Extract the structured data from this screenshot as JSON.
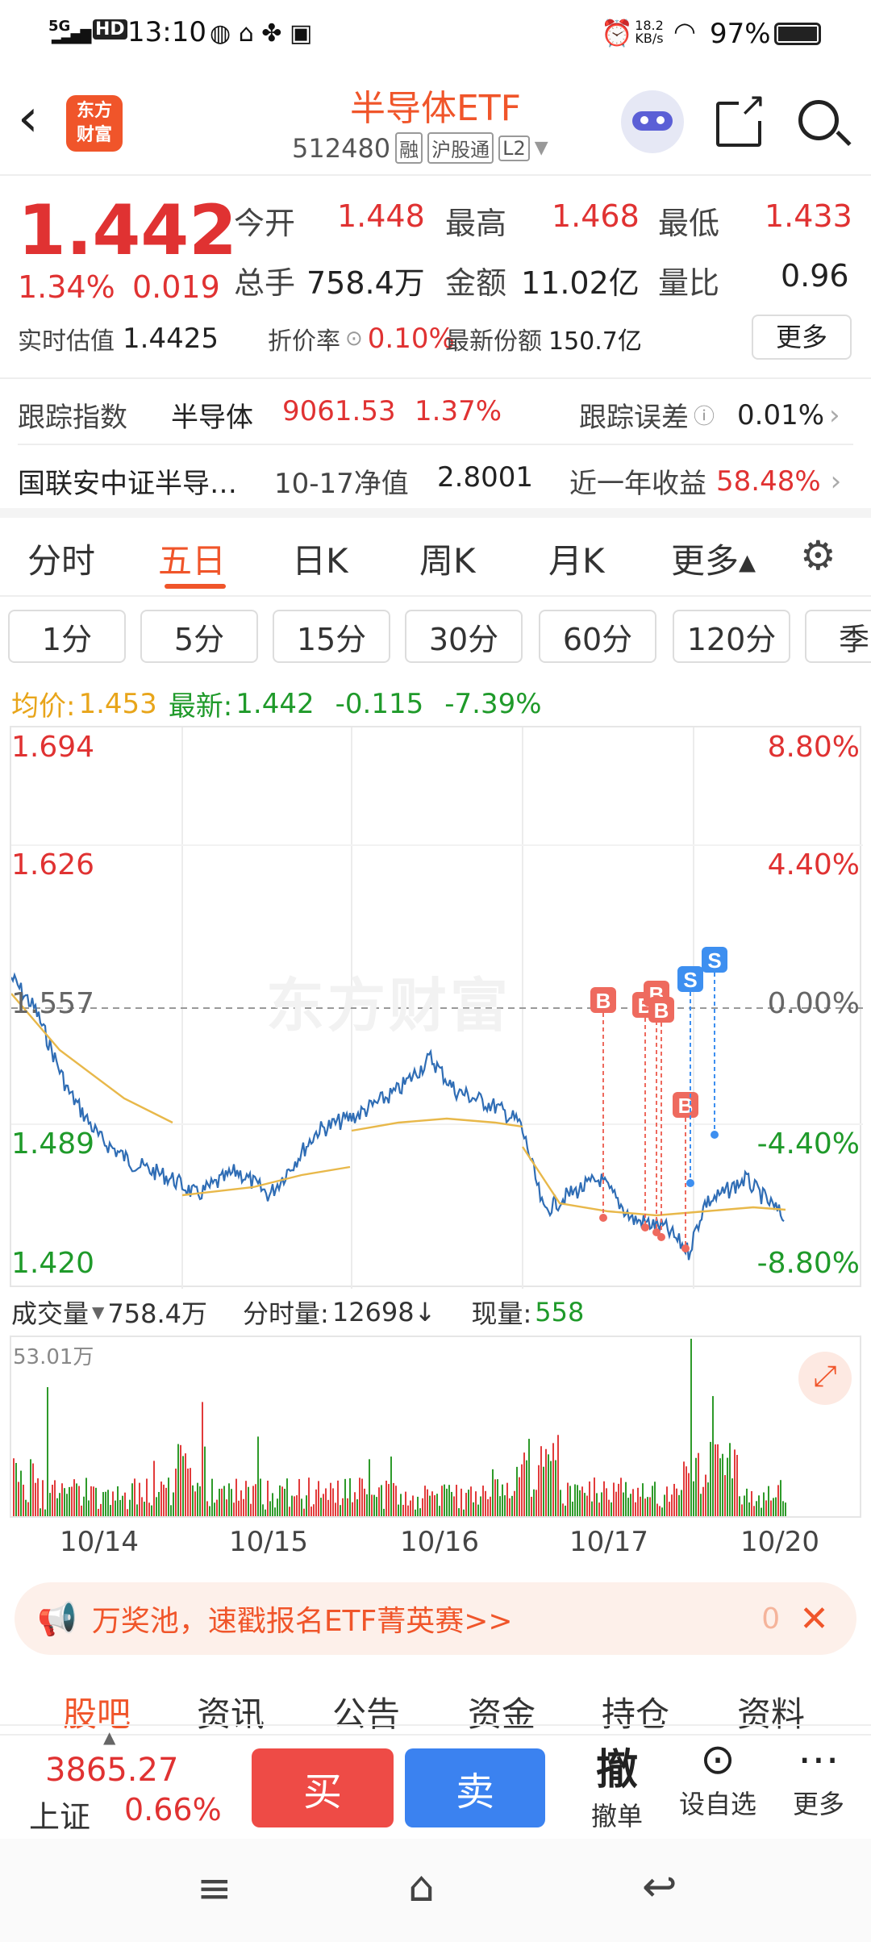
{
  "status": {
    "network": "5G",
    "hd": "HD",
    "time": "13:10",
    "speed": "18.2\nKB/s",
    "battery": "97%"
  },
  "header": {
    "brand_line1": "东方",
    "brand_line2": "财富",
    "title": "半导体ETF",
    "code": "512480",
    "tags": [
      "融",
      "沪股通",
      "L2"
    ]
  },
  "quote": {
    "price": "1.442",
    "pct": "1.34%",
    "chg": "0.019",
    "fields": [
      {
        "label": "今开",
        "value": "1.448"
      },
      {
        "label": "最高",
        "value": "1.468"
      },
      {
        "label": "最低",
        "value": "1.433"
      },
      {
        "label": "总手",
        "value": "758.4万"
      },
      {
        "label": "金额",
        "value": "11.02亿"
      },
      {
        "label": "量比",
        "value": "0.96"
      }
    ],
    "est_label": "实时估值",
    "est_value": "1.4425",
    "premium_label": "折价率",
    "premium_value": "0.10%",
    "shares_label": "最新份额",
    "shares_value": "150.7亿",
    "more": "更多"
  },
  "tracking": {
    "label": "跟踪指数",
    "index": "半导体",
    "index_value": "9061.53",
    "index_pct": "1.37%",
    "err_label": "跟踪误差",
    "err_value": "0.01%"
  },
  "fund": {
    "name": "国联安中证半导…",
    "nav_label": "10-17净值",
    "nav_value": "2.8001",
    "ret_label": "近一年收益",
    "ret_value": "58.48%"
  },
  "tabs": [
    "分时",
    "五日",
    "日K",
    "周K",
    "月K",
    "更多▴"
  ],
  "periods": [
    "1分",
    "5分",
    "15分",
    "30分",
    "60分",
    "120分",
    "季"
  ],
  "info_line": {
    "avg_label": "均价:",
    "avg": "1.453",
    "new_label": "最新:",
    "new": "1.442",
    "chg": "-0.115",
    "pct": "-7.39%"
  },
  "chart_data": {
    "type": "line",
    "y_left": [
      "1.694",
      "1.626",
      "1.557",
      "1.489",
      "1.420"
    ],
    "y_right": [
      "8.80%",
      "4.40%",
      "0.00%",
      "-4.40%",
      "-8.80%"
    ],
    "x": [
      "10/14",
      "10/15",
      "10/16",
      "10/17",
      "10/20"
    ],
    "ylim": [
      1.42,
      1.694
    ],
    "volume_max": "53.01万",
    "markers": [
      "B",
      "B",
      "B",
      "B",
      "B",
      "S",
      "S"
    ]
  },
  "volume_bar": {
    "label": "成交量",
    "total": "758.4万",
    "tick_label": "分时量:",
    "tick": "12698↓",
    "now_label": "现量:",
    "now": "558"
  },
  "banner": {
    "text": "万奖池，速戳报名ETF菁英赛>>",
    "count": "0"
  },
  "subtabs": [
    "股吧",
    "资讯",
    "公告",
    "资金",
    "持仓",
    "资料"
  ],
  "bottom": {
    "index_value": "3865.27",
    "index_name": "上证",
    "index_pct": "0.66%",
    "buy": "买",
    "sell": "卖",
    "cancel_big": "撤",
    "cancel": "撤单",
    "watch": "设自选",
    "more": "更多"
  }
}
